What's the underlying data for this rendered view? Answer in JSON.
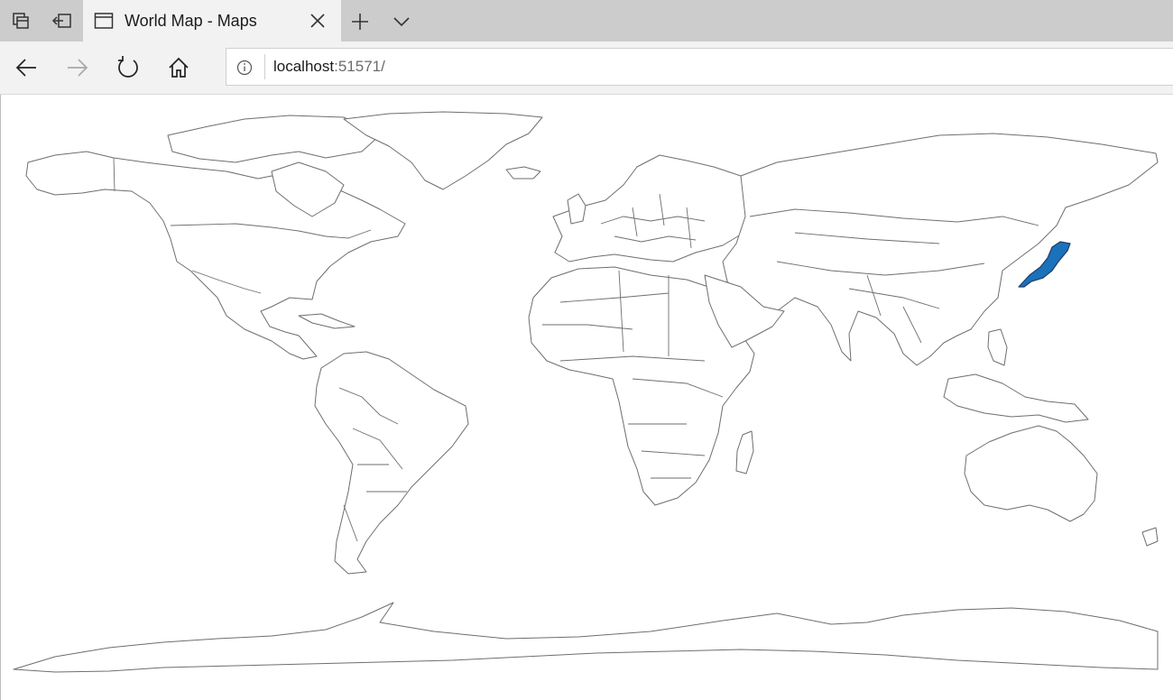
{
  "browser": {
    "tab": {
      "title": "World Map - Maps"
    },
    "address": {
      "host": "localhost",
      "port": ":51571/"
    }
  },
  "map": {
    "highlighted_country": "Japan",
    "highlight_color": "#1a72bb"
  }
}
